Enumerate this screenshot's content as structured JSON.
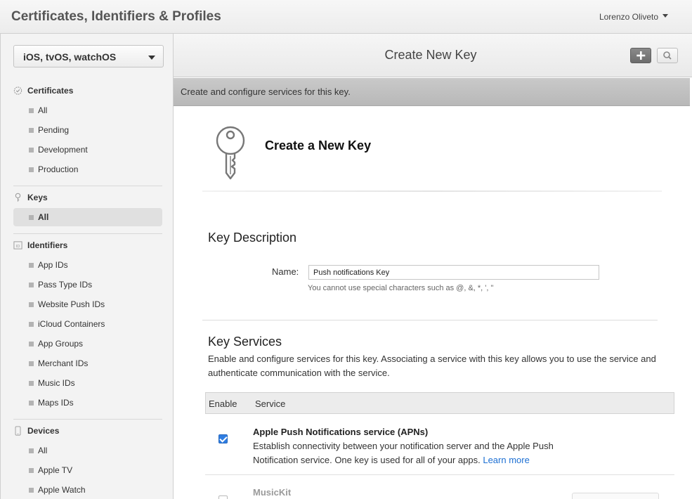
{
  "app": {
    "title": "Certificates, Identifiers & Profiles",
    "user": "Lorenzo Oliveto"
  },
  "sidebar": {
    "platform": "iOS, tvOS, watchOS",
    "sections": [
      {
        "title": "Certificates",
        "icon": "certificate-icon",
        "items": [
          "All",
          "Pending",
          "Development",
          "Production"
        ]
      },
      {
        "title": "Keys",
        "icon": "key-icon",
        "items": [
          "All"
        ]
      },
      {
        "title": "Identifiers",
        "icon": "id-icon",
        "items": [
          "App IDs",
          "Pass Type IDs",
          "Website Push IDs",
          "iCloud Containers",
          "App Groups",
          "Merchant IDs",
          "Music IDs",
          "Maps IDs"
        ]
      },
      {
        "title": "Devices",
        "icon": "device-icon",
        "items": [
          "All",
          "Apple TV",
          "Apple Watch"
        ]
      }
    ]
  },
  "main": {
    "title": "Create New Key",
    "subtitle": "Create and configure services for this key.",
    "heading": "Create a New Key",
    "key_description": {
      "title": "Key Description",
      "name_label": "Name:",
      "name_value": "Push notifications Key",
      "hint": "You cannot use special characters such as @, &, *, ', \""
    },
    "key_services": {
      "title": "Key Services",
      "description": "Enable and configure services for this key. Associating a service with this key allows you to use the service and authenticate communication with the service.",
      "col_enable": "Enable",
      "col_service": "Service",
      "services": [
        {
          "name": "Apple Push Notifications service (APNs)",
          "description": "Establish connectivity between your notification server and the Apple Push Notification service. One key is used for all of your apps.",
          "link": "Learn more",
          "enabled": true
        },
        {
          "name": "MusicKit",
          "enabled": false
        }
      ]
    }
  },
  "colors": {
    "accent": "#2f7de1",
    "link": "#1c6fd3"
  }
}
